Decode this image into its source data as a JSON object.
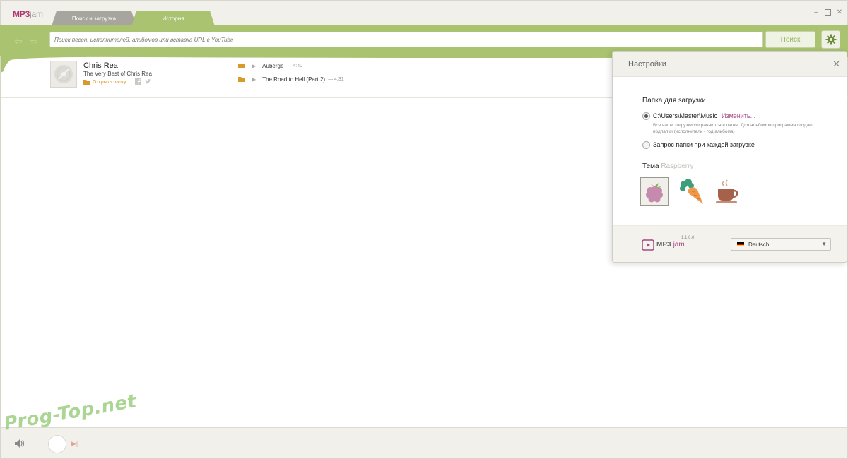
{
  "app": {
    "logo_mp3": "MP3",
    "logo_jam": "jam",
    "tabs": [
      {
        "label": "Поиск и загрузка"
      },
      {
        "label": "История"
      }
    ]
  },
  "search": {
    "placeholder": "Поиск песен, исполнителей, альбомов или вставка URL с YouTube",
    "button_label": "Поиск"
  },
  "history": {
    "albums": [
      {
        "artist": "Chris Rea",
        "album": "The Very Best of Chris Rea",
        "open_folder_label": "Открыть папку",
        "tracks": [
          {
            "title": "Auberge",
            "duration": "— 4:40"
          },
          {
            "title": "The Road to Hell (Part 2)",
            "duration": "— 4:31"
          }
        ]
      }
    ]
  },
  "settings": {
    "title": "Настройки",
    "folder_section_title": "Папка для загрузки",
    "folder_path": "C:\\Users\\Master\\Music",
    "change_link": "Изменить...",
    "hint": "Все ваши загрузки сохраняются в папке. Для альбомов программа создает подпапки (исполнитель - год альбома)",
    "ask_folder_label": "Запрос папки при каждой загрузке",
    "selected_option": "folder",
    "theme_label": "Тема",
    "theme_name": "Raspberry",
    "themes": [
      {
        "name": "raspberry-theme",
        "selected": true
      },
      {
        "name": "carrot-theme",
        "selected": false
      },
      {
        "name": "coffee-theme",
        "selected": false
      }
    ],
    "footer_logo_mp3": "MP3",
    "footer_logo_jam": "jam",
    "version": "1.1.6.0",
    "language": "Deutsch"
  },
  "watermark": "Prog-Top.net",
  "colors": {
    "accent_green": "#a9c370",
    "brand_raspberry": "#a44c84",
    "folder_orange": "#d89a2a"
  }
}
